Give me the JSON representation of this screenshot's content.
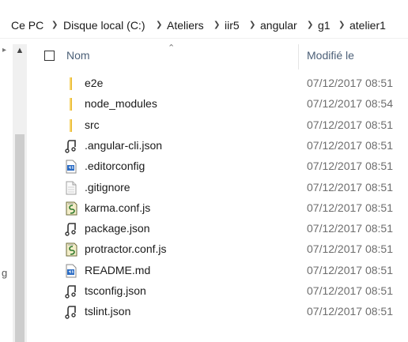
{
  "breadcrumb": {
    "items": [
      "Ce PC",
      "Disque local (C:)",
      "Ateliers",
      "iir5",
      "angular",
      "g1",
      "atelier1"
    ]
  },
  "nav": {
    "partial_text": "g"
  },
  "columns": {
    "name": "Nom",
    "modified": "Modifié le"
  },
  "files": [
    {
      "name": "e2e",
      "date": "07/12/2017 08:51",
      "icon": "folder-icon"
    },
    {
      "name": "node_modules",
      "date": "07/12/2017 08:54",
      "icon": "folder-icon"
    },
    {
      "name": "src",
      "date": "07/12/2017 08:51",
      "icon": "folder-icon"
    },
    {
      "name": ".angular-cli.json",
      "date": "07/12/2017 08:51",
      "icon": "json-file-icon"
    },
    {
      "name": ".editorconfig",
      "date": "07/12/2017 08:51",
      "icon": "config-file-icon"
    },
    {
      "name": ".gitignore",
      "date": "07/12/2017 08:51",
      "icon": "text-file-icon"
    },
    {
      "name": "karma.conf.js",
      "date": "07/12/2017 08:51",
      "icon": "script-file-icon"
    },
    {
      "name": "package.json",
      "date": "07/12/2017 08:51",
      "icon": "json-file-icon"
    },
    {
      "name": "protractor.conf.js",
      "date": "07/12/2017 08:51",
      "icon": "script-file-icon"
    },
    {
      "name": "README.md",
      "date": "07/12/2017 08:51",
      "icon": "config-file-icon"
    },
    {
      "name": "tsconfig.json",
      "date": "07/12/2017 08:51",
      "icon": "json-file-icon"
    },
    {
      "name": "tslint.json",
      "date": "07/12/2017 08:51",
      "icon": "json-file-icon"
    }
  ]
}
